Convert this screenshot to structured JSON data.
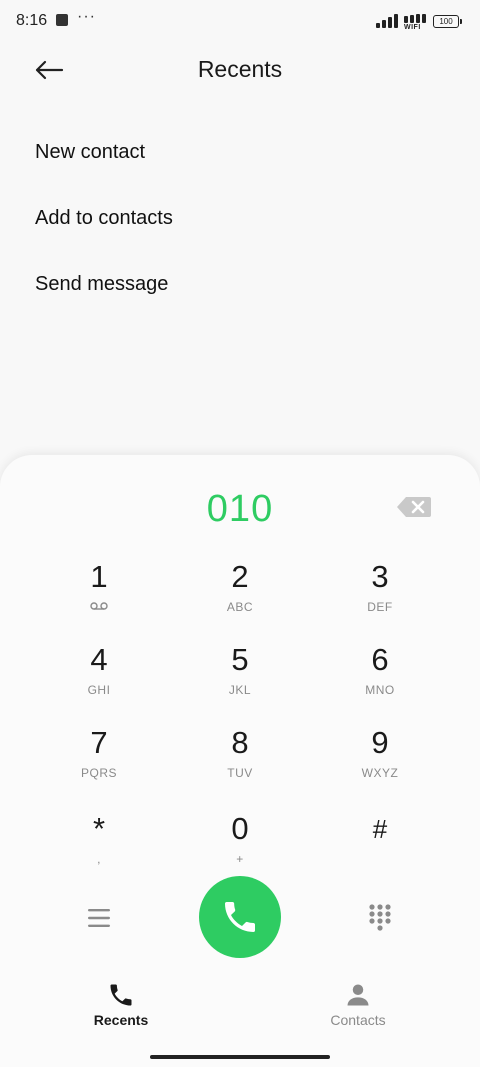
{
  "status_bar": {
    "time": "8:16",
    "more": "···",
    "network_label": "WIFI",
    "battery": "100"
  },
  "header": {
    "title": "Recents",
    "back_icon": "arrow-left-icon"
  },
  "menu": [
    {
      "label": "New contact"
    },
    {
      "label": "Add to contacts"
    },
    {
      "label": "Send message"
    }
  ],
  "dialer": {
    "number": "010",
    "accent_color": "#2ecc62",
    "keys": [
      {
        "digit": "1",
        "letters": ""
      },
      {
        "digit": "2",
        "letters": "ABC"
      },
      {
        "digit": "3",
        "letters": "DEF"
      },
      {
        "digit": "4",
        "letters": "GHI"
      },
      {
        "digit": "5",
        "letters": "JKL"
      },
      {
        "digit": "6",
        "letters": "MNO"
      },
      {
        "digit": "7",
        "letters": "PQRS"
      },
      {
        "digit": "8",
        "letters": "TUV"
      },
      {
        "digit": "9",
        "letters": "WXYZ"
      },
      {
        "digit": "*",
        "letters": ","
      },
      {
        "digit": "0",
        "letters": "+"
      },
      {
        "digit": "#",
        "letters": ""
      }
    ]
  },
  "tabs": [
    {
      "label": "Recents",
      "icon": "phone-icon",
      "active": true
    },
    {
      "label": "Contacts",
      "icon": "person-icon",
      "active": false
    }
  ]
}
